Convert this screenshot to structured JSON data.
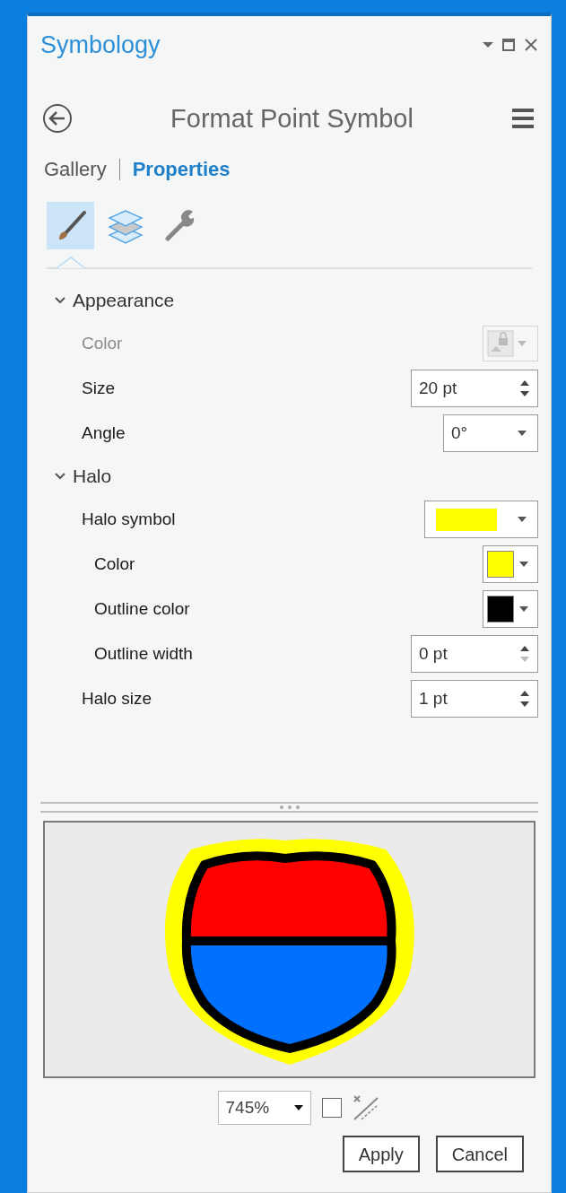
{
  "pane": {
    "title": "Symbology"
  },
  "header": {
    "title": "Format Point Symbol"
  },
  "view_tabs": [
    {
      "label": "Gallery",
      "selected": false
    },
    {
      "label": "Properties",
      "selected": true
    }
  ],
  "icon_tabs": [
    {
      "kind": "brush",
      "selected": true
    },
    {
      "kind": "layers",
      "selected": false
    },
    {
      "kind": "wrench",
      "selected": false
    }
  ],
  "sections": [
    {
      "title": "Appearance",
      "expanded": true,
      "rows": [
        {
          "label": "Color",
          "kind": "locked",
          "disabled": true
        },
        {
          "label": "Size",
          "kind": "spin",
          "value": "20 pt",
          "disabled": false,
          "decrement_disabled": false
        },
        {
          "label": "Angle",
          "kind": "dropdown",
          "value": "0°",
          "disabled": false
        }
      ]
    },
    {
      "title": "Halo",
      "expanded": true,
      "rows": [
        {
          "label": "Halo symbol",
          "kind": "symbol",
          "color": "#ffff00",
          "disabled": false,
          "children": [
            {
              "label": "Color",
              "kind": "swatch",
              "color": "#ffff00",
              "disabled": false
            },
            {
              "label": "Outline color",
              "kind": "swatch",
              "color": "#000000",
              "disabled": false
            },
            {
              "label": "Outline width",
              "kind": "spin",
              "value": "0 pt",
              "disabled": false,
              "decrement_disabled": true
            }
          ]
        },
        {
          "label": "Halo size",
          "kind": "spin",
          "value": "1 pt",
          "disabled": false,
          "decrement_disabled": false
        }
      ]
    }
  ],
  "preview": {
    "zoom": "745%",
    "checked": false
  },
  "buttons": [
    "Apply",
    "Cancel"
  ]
}
